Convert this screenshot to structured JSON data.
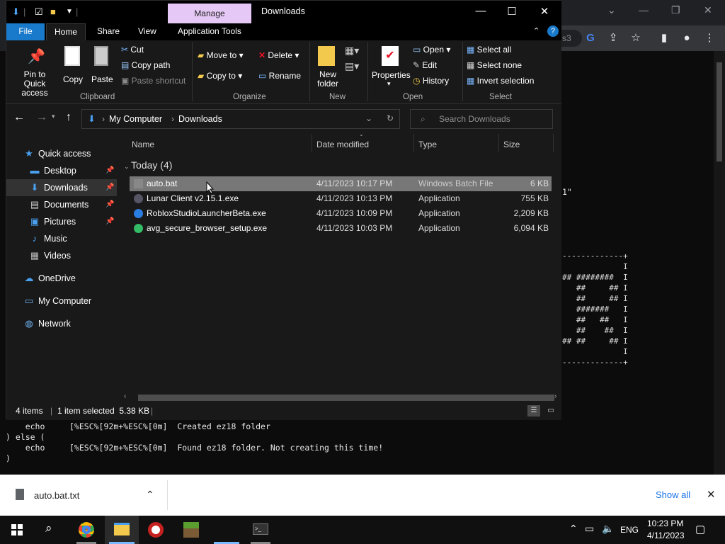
{
  "explorer": {
    "window_title": "Downloads",
    "contextual_tab": "Manage",
    "tabs": [
      "File",
      "Home",
      "Share",
      "View",
      "Application Tools"
    ],
    "ribbon": {
      "clipboard": {
        "pin": "Pin to Quick access",
        "copy": "Copy",
        "paste": "Paste",
        "cut": "Cut",
        "copy_path": "Copy path",
        "paste_shortcut": "Paste shortcut",
        "label": "Clipboard"
      },
      "organize": {
        "move_to": "Move to",
        "copy_to": "Copy to",
        "delete": "Delete",
        "rename": "Rename",
        "label": "Organize"
      },
      "new": {
        "new_folder": "New folder",
        "label": "New"
      },
      "open": {
        "properties": "Properties",
        "open": "Open",
        "edit": "Edit",
        "history": "History",
        "label": "Open"
      },
      "select": {
        "select_all": "Select all",
        "select_none": "Select none",
        "invert": "Invert selection",
        "label": "Select"
      }
    },
    "address": {
      "root": "My Computer",
      "current": "Downloads"
    },
    "search_placeholder": "Search Downloads",
    "nav": [
      {
        "label": "Quick access",
        "icon": "star-icon",
        "pinned": false
      },
      {
        "label": "Desktop",
        "icon": "desktop-icon",
        "pinned": true
      },
      {
        "label": "Downloads",
        "icon": "download-arrow-icon",
        "pinned": true
      },
      {
        "label": "Documents",
        "icon": "documents-icon",
        "pinned": true
      },
      {
        "label": "Pictures",
        "icon": "pictures-icon",
        "pinned": true
      },
      {
        "label": "Music",
        "icon": "music-icon",
        "pinned": false
      },
      {
        "label": "Videos",
        "icon": "videos-icon",
        "pinned": false
      },
      {
        "label": "OneDrive",
        "icon": "cloud-icon",
        "pinned": false
      },
      {
        "label": "My Computer",
        "icon": "computer-icon",
        "pinned": false
      },
      {
        "label": "Network",
        "icon": "network-icon",
        "pinned": false
      }
    ],
    "columns": {
      "name": "Name",
      "date": "Date modified",
      "type": "Type",
      "size": "Size"
    },
    "group_header": "Today (4)",
    "files": [
      {
        "name": "auto.bat",
        "date": "4/11/2023 10:17 PM",
        "type": "Windows Batch File",
        "size": "6 KB"
      },
      {
        "name": "Lunar Client v2.15.1.exe",
        "date": "4/11/2023 10:13 PM",
        "type": "Application",
        "size": "755 KB"
      },
      {
        "name": "RobloxStudioLauncherBeta.exe",
        "date": "4/11/2023 10:09 PM",
        "type": "Application",
        "size": "2,209 KB"
      },
      {
        "name": "avg_secure_browser_setup.exe",
        "date": "4/11/2023 10:03 PM",
        "type": "Application",
        "size": "6,094 KB"
      }
    ],
    "status": {
      "count": "4 items",
      "selection": "1 item selected  5.38 KB"
    }
  },
  "console": {
    "lines": [
      "    echo     [%ESC%[92m+%ESC%[0m]  Created ez18 folder",
      ") else (",
      "    echo     [%ESC%[92m+%ESC%[0m]  Found ez18 folder. Not creating this time!",
      ")"
    ],
    "ascii": [
      "-------------+",
      "             I",
      "## ########  I",
      "   ##     ## I",
      "   ##     ## I",
      "   #######   I",
      "   ##   ##   I",
      "   ##    ##  I",
      "## ##     ## I",
      "             I",
      "-------------+"
    ],
    "partial_text": "1\""
  },
  "chrome": {
    "url_fragment": "s3"
  },
  "download_bar": {
    "file": "auto.bat.txt",
    "show_all": "Show all"
  },
  "taskbar": {
    "time": "10:23 PM",
    "date": "4/11/2023",
    "lang": "ENG"
  }
}
